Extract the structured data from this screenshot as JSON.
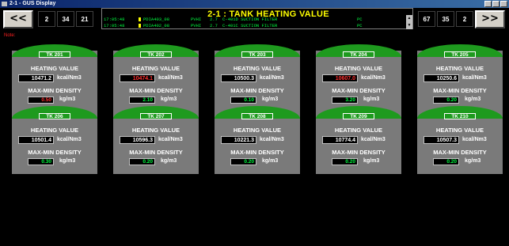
{
  "window": {
    "title": "2-1 - GUS Display"
  },
  "nav": {
    "prev_label": "<<",
    "next_label": ">>",
    "left_nums": [
      "2",
      "34",
      "21"
    ],
    "right_nums": [
      "67",
      "35",
      "2"
    ]
  },
  "alarm": {
    "title": "2-1 : TANK HEATING VALUE",
    "rows": [
      {
        "time": "17:05:48",
        "tag": "PDIA403_08",
        "param": "PVHI",
        "val": "2.7",
        "desc": "C-401D SUCTION FILTER",
        "unit": "PC"
      },
      {
        "time": "17:05:48",
        "tag": "PDIA402_08",
        "param": "PVHI",
        "val": "2.7",
        "desc": "C-401C SUCTION FILTER",
        "unit": "PC"
      }
    ]
  },
  "note": "Note:",
  "labels": {
    "hv": "HEATING VALUE",
    "den": "MAX-MIN DENSITY",
    "hv_unit": "kcal/Nm3",
    "den_unit": "kg/m3"
  },
  "tanks": [
    {
      "name": "TK 201",
      "hv": "10471.2",
      "den": "0.50",
      "hv_color": "#ffffff",
      "den_color": "#ff3030"
    },
    {
      "name": "TK 202",
      "hv": "10474.1",
      "den": "2.10",
      "hv_color": "#ff3030",
      "den_color": "#00ff40"
    },
    {
      "name": "TK 203",
      "hv": "10500.3",
      "den": "0.10",
      "hv_color": "#ffffff",
      "den_color": "#00ff40"
    },
    {
      "name": "TK 204",
      "hv": "10607.0",
      "den": "3.20",
      "hv_color": "#ff3030",
      "den_color": "#00ff40"
    },
    {
      "name": "TK 205",
      "hv": "10250.6",
      "den": "0.20",
      "hv_color": "#ffffff",
      "den_color": "#00ff40"
    },
    {
      "name": "TK 206",
      "hv": "10501.4",
      "den": "0.30",
      "hv_color": "#ffffff",
      "den_color": "#00ff40"
    },
    {
      "name": "TK 207",
      "hv": "10596.3",
      "den": "0.20",
      "hv_color": "#ffffff",
      "den_color": "#00ff40"
    },
    {
      "name": "TK 208",
      "hv": "10221.3",
      "den": "0.20",
      "hv_color": "#ffffff",
      "den_color": "#00ff40"
    },
    {
      "name": "TK 209",
      "hv": "10774.4",
      "den": "0.20",
      "hv_color": "#ffffff",
      "den_color": "#00ff40"
    },
    {
      "name": "TK 210",
      "hv": "10507.3",
      "den": "0.20",
      "hv_color": "#ffffff",
      "den_color": "#00ff40"
    }
  ],
  "colors": {
    "tank_body": "#7a7a7a",
    "tank_cap": "#1e9a1e",
    "alarm_text": "#00ff40",
    "title_text": "#ffff00",
    "highlight": "#ff0000"
  }
}
